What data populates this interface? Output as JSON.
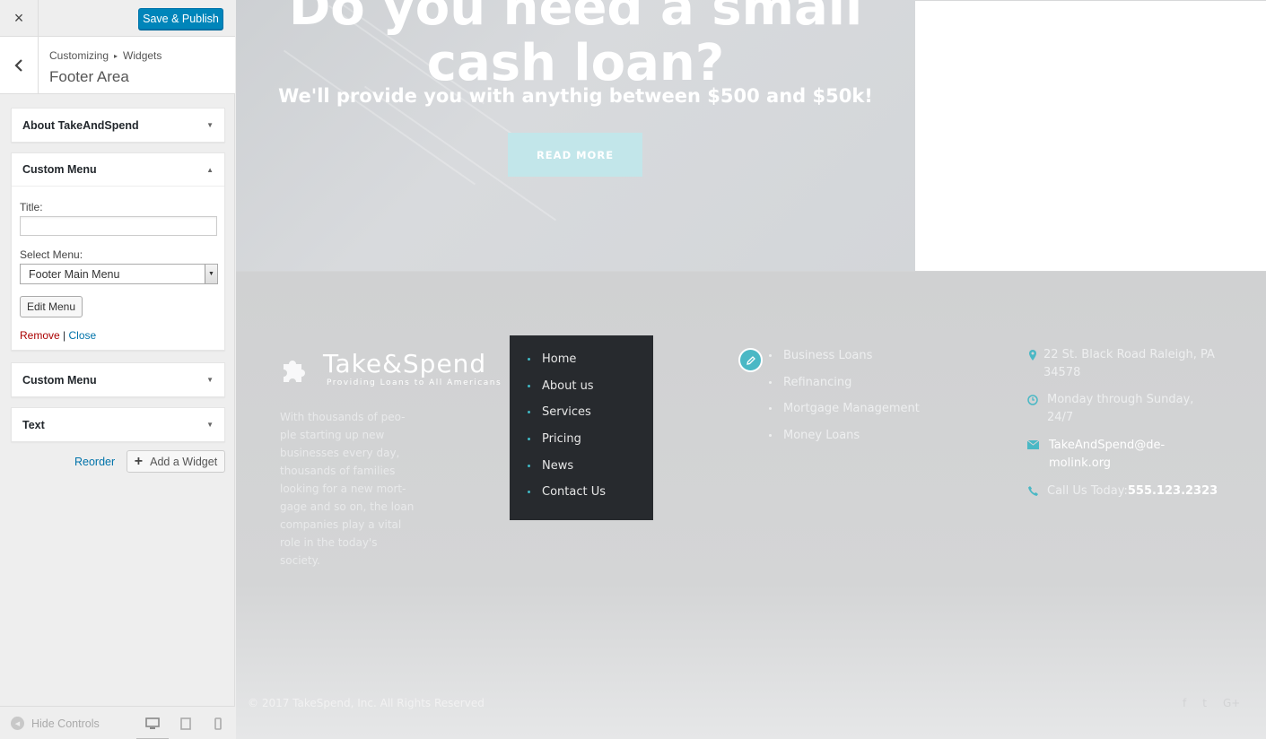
{
  "customizer": {
    "close_label": "×",
    "save_label": "Save & Publish",
    "breadcrumb": {
      "root": "Customizing",
      "separator": "▸",
      "section": "Widgets"
    },
    "panel_title": "Footer Area",
    "widgets": [
      {
        "title": "About TakeAndSpend",
        "state": "collapsed"
      },
      {
        "title": "Custom Menu",
        "state": "expanded"
      },
      {
        "title": "Custom Menu",
        "state": "collapsed"
      },
      {
        "title": "Text",
        "state": "collapsed"
      }
    ],
    "expanded_form": {
      "title_label": "Title:",
      "title_value": "",
      "select_label": "Select Menu:",
      "select_value": "Footer Main Menu",
      "edit_menu_label": "Edit Menu",
      "remove_label": "Remove",
      "divider": "|",
      "close_label": "Close"
    },
    "reorder_label": "Reorder",
    "add_widget_label": "Add a Widget",
    "hide_controls_label": "Hide Controls",
    "devices": [
      "desktop-icon",
      "tablet-icon",
      "mobile-icon"
    ],
    "active_device": "desktop"
  },
  "preview": {
    "hero": {
      "heading": "Do you need a small cash loan?",
      "subheading": "We'll provide you with anythig between $500 and $50k!",
      "button_label": "READ MORE",
      "button_color": "#c2e6ea"
    },
    "footer": {
      "logo_name": "Take&Spend",
      "logo_tagline": "Providing Loans to All Americans",
      "about_text": "With thousands of peo-ple starting up new businesses every day, thousands of families looking for a new mort-gage and so on, the loan companies play a vital role in the today's society.",
      "menu_items": [
        "Home",
        "About us",
        "Services",
        "Pricing",
        "News",
        "Contact Us"
      ],
      "services": [
        "Business Loans",
        "Refinancing",
        "Mortgage Management",
        "Money Loans"
      ],
      "contact": {
        "address": "22 St. Black Road Raleigh, PA 34578",
        "hours": "Monday through Sunday, 24/7",
        "email": "TakeAndSpend@de-molink.org",
        "phone_label": "Call Us Today:",
        "phone": "555.123.2323"
      },
      "copyright": "© 2017 TakeSpend, Inc. All Rights Reserved",
      "social": [
        "f",
        "t",
        "G+"
      ]
    },
    "colors": {
      "accent": "#3fb8c4",
      "menu_bg": "#272a2e",
      "save_button": "#0085ba"
    }
  }
}
